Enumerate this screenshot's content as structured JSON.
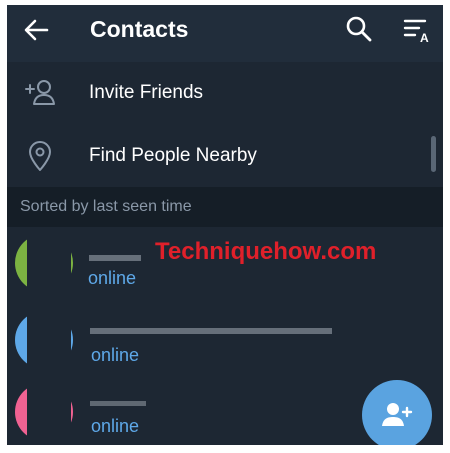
{
  "header": {
    "title": "Contacts",
    "icons": {
      "back": "arrow-left-icon",
      "search": "search-icon",
      "sort": "sort-alphabet-icon"
    }
  },
  "menu": {
    "items": [
      {
        "label": "Invite Friends",
        "icon": "add-person-icon"
      },
      {
        "label": "Find People Nearby",
        "icon": "location-pin-icon"
      }
    ]
  },
  "section": {
    "label": "Sorted by last seen time"
  },
  "contacts": [
    {
      "status": "online",
      "avatar_color": "#7cb342"
    },
    {
      "status": "online",
      "avatar_color": "#5ea8e8"
    },
    {
      "status": "online",
      "avatar_color": "#f06292"
    }
  ],
  "watermark": {
    "text": "Techniquehow.com"
  },
  "fab": {
    "icon": "add-contact-icon"
  },
  "colors": {
    "background": "#1d2733",
    "header": "#212d3b",
    "section": "#151e27",
    "accent": "#5ea8e8",
    "fab": "#5aa3e0",
    "watermark": "#e0202a"
  }
}
